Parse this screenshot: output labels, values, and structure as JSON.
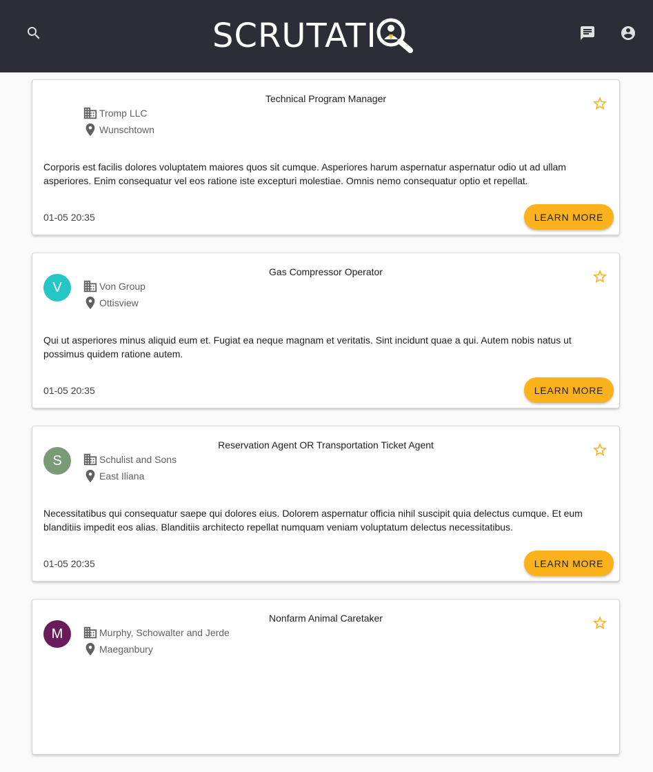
{
  "header": {
    "logo_text": "SCRUTATI",
    "icons": {
      "search": "search-icon",
      "chat": "chat-icon",
      "account": "account-circle-icon"
    },
    "colors": {
      "background": "#2d2d37",
      "accent": "#fbb21c"
    }
  },
  "jobs": [
    {
      "title": "Technical Program Manager",
      "company": "Tromp LLC",
      "location": "Wunschtown",
      "avatar_letter": "",
      "avatar_color": "",
      "description": "Corporis est facilis dolores voluptatem maiores quos sit cumque. Asperiores harum aspernatur aspernatur odio ut ad ullam asperiores. Enim consequatur vel eos ratione iste excepturi molestiae. Omnis nemo consequatur optio et repellat.",
      "date": "01-05 20:35",
      "button_label": "LEARN MORE"
    },
    {
      "title": "Gas Compressor Operator",
      "company": "Von Group",
      "location": "Ottisview",
      "avatar_letter": "V",
      "avatar_color": "#26c6c6",
      "description": "Qui ut asperiores minus aliquid eum et. Fugiat ea neque magnam et veritatis. Sint incidunt quae a qui. Autem nobis natus ut possimus quidem ratione autem.",
      "date": "01-05 20:35",
      "button_label": "LEARN MORE"
    },
    {
      "title": "Reservation Agent OR Transportation Ticket Agent",
      "company": "Schulist and Sons",
      "location": "East Iliana",
      "avatar_letter": "S",
      "avatar_color": "#7a9a78",
      "description": "Necessitatibus qui consequatur saepe qui dolores eius. Dolorem aspernatur officia nihil suscipit quia delectus cumque. Et eum blanditiis impedit eos alias. Blanditiis architecto repellat numquam veniam voluptatum delectus necessitatibus.",
      "date": "01-05 20:35",
      "button_label": "LEARN MORE"
    },
    {
      "title": "Nonfarm Animal Caretaker",
      "company": "Murphy, Schowalter and Jerde",
      "location": "Maeganbury",
      "avatar_letter": "M",
      "avatar_color": "#6a1b5a",
      "description": "",
      "date": "",
      "button_label": ""
    }
  ],
  "icons": {
    "company": "business-icon",
    "location": "location-pin-icon",
    "favorite": "star-outline-icon"
  }
}
